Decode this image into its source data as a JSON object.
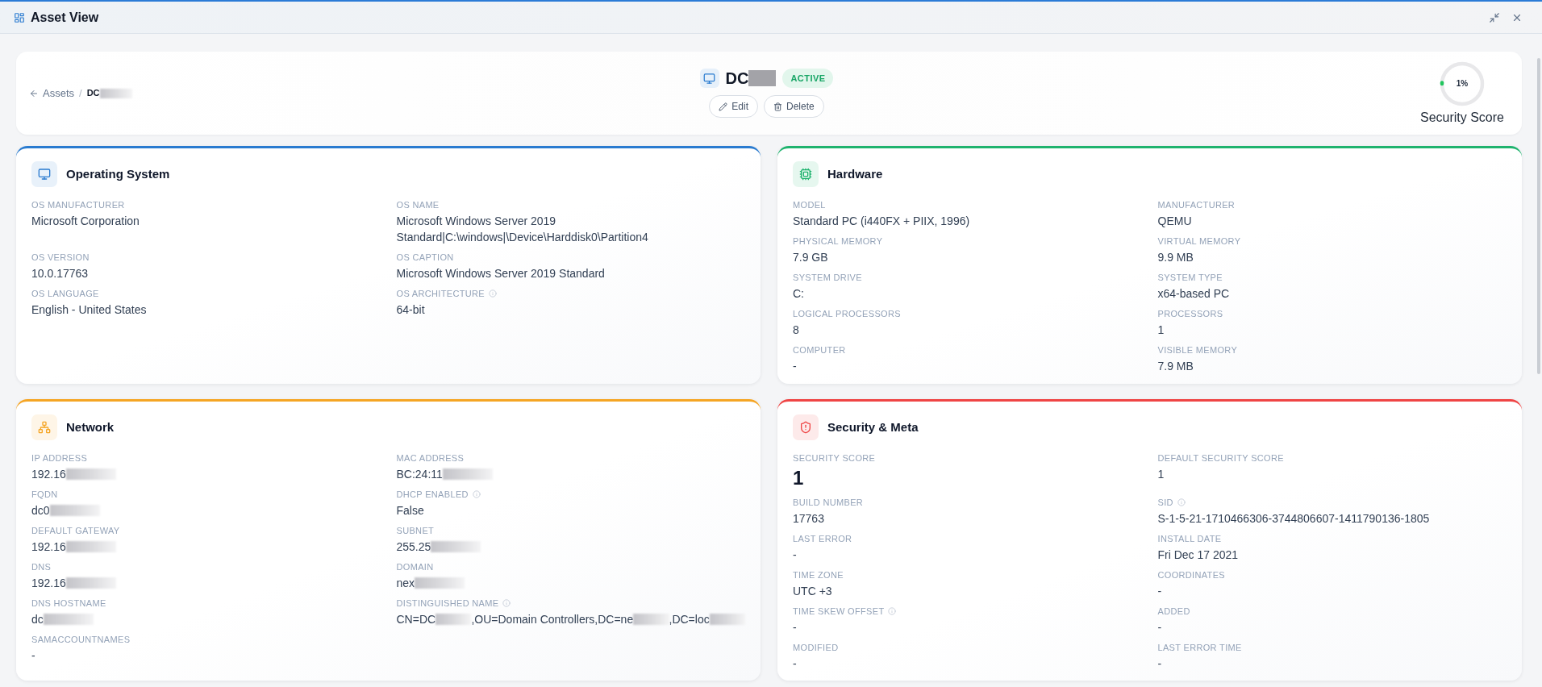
{
  "window": {
    "title": "Asset View"
  },
  "breadcrumb": {
    "back": "Assets",
    "separator": "/",
    "current": "DC",
    "current_redacted": true
  },
  "asset": {
    "name": "DC",
    "name_redacted": true,
    "status": {
      "label": "ACTIVE",
      "kind": "active"
    },
    "actions": [
      "Edit",
      "Delete"
    ]
  },
  "security_score_gauge": {
    "reading": "1%",
    "level": 0.01,
    "label": "Security Score"
  },
  "cards": [
    {
      "title": "Operating System",
      "color": "#2a7bd0",
      "fields": [
        {
          "label": "OS MANUFACTURER",
          "value": "Microsoft Corporation",
          "info": false
        },
        {
          "label": "OS NAME",
          "value": "Microsoft Windows Server 2019 Standard|C:\\windows|\\Device\\Harddisk0\\Partition4",
          "info": false
        },
        {
          "label": "OS VERSION",
          "value": "10.0.17763",
          "info": false
        },
        {
          "label": "OS CAPTION",
          "value": "Microsoft Windows Server 2019 Standard",
          "info": false
        },
        {
          "label": "OS LANGUAGE",
          "value": "English - United States",
          "info": false
        },
        {
          "label": "OS ARCHITECTURE",
          "value": "64-bit",
          "info": true
        }
      ]
    },
    {
      "title": "Hardware",
      "color": "#1fb36e",
      "fields": [
        {
          "label": "MODEL",
          "value": "Standard PC (i440FX + PIIX, 1996)",
          "info": false
        },
        {
          "label": "MANUFACTURER",
          "value": "QEMU",
          "info": false
        },
        {
          "label": "PHYSICAL MEMORY",
          "value": "7.9 GB",
          "info": false
        },
        {
          "label": "VIRTUAL MEMORY",
          "value": "9.9 MB",
          "info": false
        },
        {
          "label": "SYSTEM DRIVE",
          "value": "C:",
          "info": false
        },
        {
          "label": "SYSTEM TYPE",
          "value": "x64-based PC",
          "info": false
        },
        {
          "label": "LOGICAL PROCESSORS",
          "value": "8",
          "info": false
        },
        {
          "label": "PROCESSORS",
          "value": "1",
          "info": false
        },
        {
          "label": "COMPUTER",
          "value": "-",
          "info": false
        },
        {
          "label": "VISIBLE MEMORY",
          "value": "7.9 MB",
          "info": false
        }
      ]
    },
    {
      "title": "Network",
      "color": "#f5a524",
      "fields": [
        {
          "label": "IP ADDRESS",
          "value": "192.16",
          "info": false,
          "redacted": true
        },
        {
          "label": "MAC ADDRESS",
          "value": "BC:24:11",
          "info": false,
          "redacted": true
        },
        {
          "label": "FQDN",
          "value": "dc0",
          "info": false,
          "redacted": true
        },
        {
          "label": "DHCP ENABLED",
          "value": "False",
          "info": true,
          "redacted": false
        },
        {
          "label": "DEFAULT GATEWAY",
          "value": "192.16",
          "info": false,
          "redacted": true
        },
        {
          "label": "SUBNET",
          "value": "255.25",
          "info": false,
          "redacted": true
        },
        {
          "label": "DNS",
          "value": "192.16",
          "info": false,
          "redacted": true
        },
        {
          "label": "DOMAIN",
          "value": "nex",
          "info": false,
          "redacted": true
        },
        {
          "label": "DNS HOSTNAME",
          "value": "dc",
          "info": false,
          "redacted": true
        },
        {
          "label": "DISTINGUISHED NAME",
          "value": [
            "CN=DC",
            ",OU=Domain Controllers,DC=ne",
            ",DC=loc"
          ],
          "info": true,
          "redacted": true
        },
        {
          "label": "SAMACCOUNTNAMES",
          "value": "-",
          "info": false,
          "redacted": false
        }
      ]
    },
    {
      "title": "Security & Meta",
      "color": "#ef4444",
      "fields": [
        {
          "label": "SECURITY SCORE",
          "value": "1",
          "info": false,
          "large": true
        },
        {
          "label": "DEFAULT SECURITY SCORE",
          "value": "1",
          "info": false,
          "large": false
        },
        {
          "label": "BUILD NUMBER",
          "value": "17763",
          "info": false,
          "large": false
        },
        {
          "label": "SID",
          "value": "S-1-5-21-1710466306-3744806607-1411790136-1805",
          "info": true,
          "large": false
        },
        {
          "label": "LAST ERROR",
          "value": "-",
          "info": false,
          "large": false
        },
        {
          "label": "INSTALL DATE",
          "value": "Fri Dec 17 2021",
          "info": false,
          "large": false
        },
        {
          "label": "TIME ZONE",
          "value": "UTC +3",
          "info": false,
          "large": false
        },
        {
          "label": "COORDINATES",
          "value": "-",
          "info": false,
          "large": false
        },
        {
          "label": "TIME SKEW OFFSET",
          "value": "-",
          "info": true,
          "large": false
        },
        {
          "label": "ADDED",
          "value": "-",
          "info": false,
          "large": false
        },
        {
          "label": "MODIFIED",
          "value": "-",
          "info": false,
          "large": false
        },
        {
          "label": "LAST ERROR TIME",
          "value": "-",
          "info": false,
          "large": false
        }
      ]
    }
  ]
}
